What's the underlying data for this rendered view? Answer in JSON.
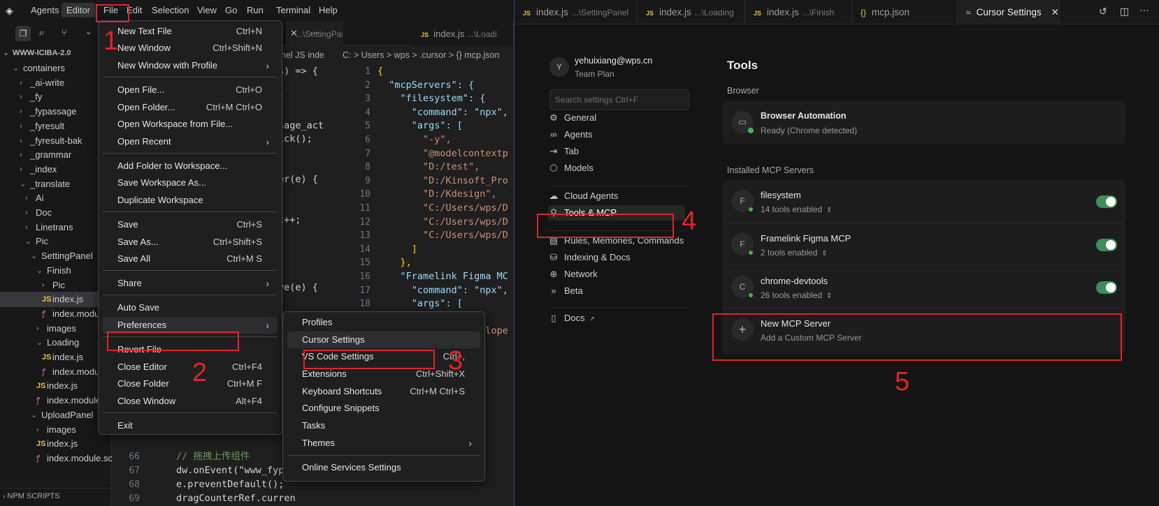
{
  "menubar": {
    "items": [
      "Agents",
      "Editor",
      "File",
      "Edit",
      "Selection",
      "View",
      "Go",
      "Run",
      "Terminal",
      "Help"
    ]
  },
  "explorer": {
    "root": "WWW-ICIBA-2.0",
    "rows": [
      {
        "label": "containers",
        "chev": "v"
      },
      {
        "label": "_ai-write",
        "chev": ">"
      },
      {
        "label": "_fy",
        "chev": ">"
      },
      {
        "label": "_fypassage",
        "chev": ">"
      },
      {
        "label": "_fyresult",
        "chev": ">"
      },
      {
        "label": "_fyresult-bak",
        "chev": ">"
      },
      {
        "label": "_grammar",
        "chev": ">"
      },
      {
        "label": "_index",
        "chev": ">"
      },
      {
        "label": "_translate",
        "chev": "v"
      },
      {
        "label": "Ai",
        "chev": ">"
      },
      {
        "label": "Doc",
        "chev": ">"
      },
      {
        "label": "Linetrans",
        "chev": ">"
      },
      {
        "label": "Pic",
        "chev": "v"
      },
      {
        "label": "SettingPanel",
        "chev": "v"
      },
      {
        "label": "Finish",
        "chev": "v"
      },
      {
        "label": "Pic",
        "chev": ">"
      },
      {
        "label": "index.js",
        "chev": "js"
      },
      {
        "label": "index.module.scss",
        "chev": "scss"
      },
      {
        "label": "images",
        "chev": ">"
      },
      {
        "label": "Loading",
        "chev": "v"
      },
      {
        "label": "index.js",
        "chev": "js"
      },
      {
        "label": "index.module.scss",
        "chev": "scss"
      },
      {
        "label": "index.js",
        "chev": "js"
      },
      {
        "label": "index.module.scss",
        "chev": "scss"
      },
      {
        "label": "UploadPanel",
        "chev": "v"
      },
      {
        "label": "images",
        "chev": ">"
      },
      {
        "label": "index.js",
        "chev": "js"
      },
      {
        "label": "index.module.scss",
        "chev": "scss"
      }
    ],
    "npm_scripts": "NPM SCRIPTS"
  },
  "editorA": {
    "tab_label": "index.js",
    "tab_path": "...\\SettingPanel",
    "breadcrumb": "nel  JS inde",
    "lines": [
      {
        "n": "",
        "t": "s) => {"
      },
      {
        "n": "",
        "t": ""
      },
      {
        "n": "",
        "t": "{"
      },
      {
        "n": "",
        "t": ""
      },
      {
        "n": "",
        "t": "sage_act"
      },
      {
        "n": "",
        "t": "ick();"
      },
      {
        "n": "",
        "t": ""
      },
      {
        "n": "",
        "t": ""
      },
      {
        "n": "",
        "t": "er(e) {"
      },
      {
        "n": "",
        "t": ""
      },
      {
        "n": "",
        "t": ""
      },
      {
        "n": "",
        "t": "t++;"
      },
      {
        "n": "",
        "t": ""
      },
      {
        "n": "",
        "t": ""
      },
      {
        "n": "",
        "t": ""
      },
      {
        "n": "",
        "t": ""
      },
      {
        "n": "",
        "t": "ve(e) {"
      },
      {
        "n": "",
        "t": ""
      },
      {
        "n": "",
        "t": ""
      },
      {
        "n": "",
        "t": "t--;"
      }
    ],
    "bottom_lines": [
      {
        "n": "66",
        "t": "// 拖拽上传组件"
      },
      {
        "n": "67",
        "t": "dw.onEvent(\"www_fypas"
      },
      {
        "n": "68",
        "t": "e.preventDefault();"
      },
      {
        "n": "69",
        "t": "dragCounterRef.curren"
      }
    ]
  },
  "editorB": {
    "tabs": [
      {
        "label": "index.js",
        "path": "...\\Loadi"
      }
    ],
    "breadcrumb": "C: > Users > wps > .cursor > {} mcp.json",
    "lines": [
      {
        "n": "1",
        "t": "{"
      },
      {
        "n": "2",
        "t": "  \"mcpServers\": {"
      },
      {
        "n": "3",
        "t": "    \"filesystem\": {"
      },
      {
        "n": "4",
        "t": "      \"command\": \"npx\","
      },
      {
        "n": "5",
        "t": "      \"args\": ["
      },
      {
        "n": "6",
        "t": "        \"-y\","
      },
      {
        "n": "7",
        "t": "        \"@modelcontextp"
      },
      {
        "n": "8",
        "t": "        \"D:/test\","
      },
      {
        "n": "9",
        "t": "        \"D:/Kinsoft_Pro"
      },
      {
        "n": "10",
        "t": "        \"D:/Kdesign\","
      },
      {
        "n": "11",
        "t": "        \"C:/Users/wps/D"
      },
      {
        "n": "12",
        "t": "        \"C:/Users/wps/D"
      },
      {
        "n": "13",
        "t": "        \"C:/Users/wps/D"
      },
      {
        "n": "14",
        "t": "      ]"
      },
      {
        "n": "15",
        "t": "    },"
      },
      {
        "n": "16",
        "t": "    \"Framelink Figma MC"
      },
      {
        "n": "17",
        "t": "      \"command\": \"npx\","
      },
      {
        "n": "18",
        "t": "      \"args\": ["
      },
      {
        "n": "19",
        "t": "        \"-y\","
      },
      {
        "n": "20",
        "t": "        \"figma-develope"
      }
    ]
  },
  "file_menu": {
    "items": [
      {
        "label": "New Text File",
        "shortcut": "Ctrl+N"
      },
      {
        "label": "New Window",
        "shortcut": "Ctrl+Shift+N"
      },
      {
        "label": "New Window with Profile",
        "shortcut": "",
        "arrow": ">"
      },
      {
        "label": "Open File...",
        "shortcut": "Ctrl+O"
      },
      {
        "label": "Open Folder...",
        "shortcut": "Ctrl+M Ctrl+O"
      },
      {
        "label": "Open Workspace from File...",
        "shortcut": ""
      },
      {
        "label": "Open Recent",
        "shortcut": "",
        "arrow": ">"
      },
      {
        "label": "Add Folder to Workspace...",
        "shortcut": ""
      },
      {
        "label": "Save Workspace As...",
        "shortcut": ""
      },
      {
        "label": "Duplicate Workspace",
        "shortcut": ""
      },
      {
        "label": "Save",
        "shortcut": "Ctrl+S"
      },
      {
        "label": "Save As...",
        "shortcut": "Ctrl+Shift+S"
      },
      {
        "label": "Save All",
        "shortcut": "Ctrl+M S"
      },
      {
        "label": "Share",
        "shortcut": "",
        "arrow": ">"
      },
      {
        "label": "Auto Save",
        "shortcut": ""
      },
      {
        "label": "Preferences",
        "shortcut": "",
        "arrow": ">"
      },
      {
        "label": "Revert File",
        "shortcut": ""
      },
      {
        "label": "Close Editor",
        "shortcut": "Ctrl+F4"
      },
      {
        "label": "Close Folder",
        "shortcut": "Ctrl+M F"
      },
      {
        "label": "Close Window",
        "shortcut": "Alt+F4"
      },
      {
        "label": "Exit",
        "shortcut": ""
      }
    ]
  },
  "prefs_menu": {
    "items": [
      {
        "label": "Profiles",
        "shortcut": ""
      },
      {
        "label": "Cursor Settings",
        "shortcut": ""
      },
      {
        "label": "VS Code Settings",
        "shortcut": "Ctrl+,"
      },
      {
        "label": "Extensions",
        "shortcut": "Ctrl+Shift+X"
      },
      {
        "label": "Keyboard Shortcuts",
        "shortcut": "Ctrl+M Ctrl+S"
      },
      {
        "label": "Configure Snippets",
        "shortcut": ""
      },
      {
        "label": "Tasks",
        "shortcut": ""
      },
      {
        "label": "Themes",
        "shortcut": "",
        "arrow": ">"
      },
      {
        "label": "Online Services Settings",
        "shortcut": ""
      }
    ]
  },
  "right_tabs": [
    {
      "label": "index.js",
      "path": "...\\SettingPanel",
      "icon": "JS"
    },
    {
      "label": "index.js",
      "path": "...\\Loading",
      "icon": "JS"
    },
    {
      "label": "index.js",
      "path": "...\\Finish",
      "icon": "JS"
    },
    {
      "label": "mcp.json",
      "path": "",
      "icon": "{}"
    },
    {
      "label": "Cursor Settings",
      "path": "",
      "icon": "≈"
    }
  ],
  "settings": {
    "user_email": "yehuixiang@wps.cn",
    "user_plan": "Team Plan",
    "user_initial": "Y",
    "search_placeholder": "Search settings Ctrl+F",
    "nav": [
      {
        "label": "General",
        "icon": "gear-icon"
      },
      {
        "label": "Agents",
        "icon": "infinity-icon"
      },
      {
        "label": "Tab",
        "icon": "tab-arrow-icon"
      },
      {
        "label": "Models",
        "icon": "cube-icon"
      },
      {
        "label": "Cloud Agents",
        "icon": "cloud-icon"
      },
      {
        "label": "Tools & MCP",
        "icon": "nodes-icon"
      },
      {
        "label": "Rules, Memories, Commands",
        "icon": "document-icon"
      },
      {
        "label": "Indexing & Docs",
        "icon": "database-icon"
      },
      {
        "label": "Network",
        "icon": "globe-icon"
      },
      {
        "label": "Beta",
        "icon": "chevrons-icon"
      },
      {
        "label": "Docs",
        "icon": "book-icon"
      }
    ],
    "page_title": "Tools",
    "browser_section": "Browser",
    "browser_title": "Browser Automation",
    "browser_status": "Ready (Chrome detected)",
    "installed_section": "Installed MCP Servers",
    "servers": [
      {
        "initial": "F",
        "name": "filesystem",
        "tools": "14 tools enabled",
        "enabled": true
      },
      {
        "initial": "F",
        "name": "Framelink Figma MCP",
        "tools": "2 tools enabled",
        "enabled": true
      },
      {
        "initial": "C",
        "name": "chrome-devtools",
        "tools": "26 tools enabled",
        "enabled": true
      }
    ],
    "new_server_title": "New MCP Server",
    "new_server_sub": "Add a Custom MCP Server"
  },
  "annotations": [
    "1",
    "2",
    "3",
    "4",
    "5"
  ],
  "colors": {
    "annotation": "#e3232a",
    "accent": "#3e8e57",
    "status_green": "#3fb950"
  }
}
